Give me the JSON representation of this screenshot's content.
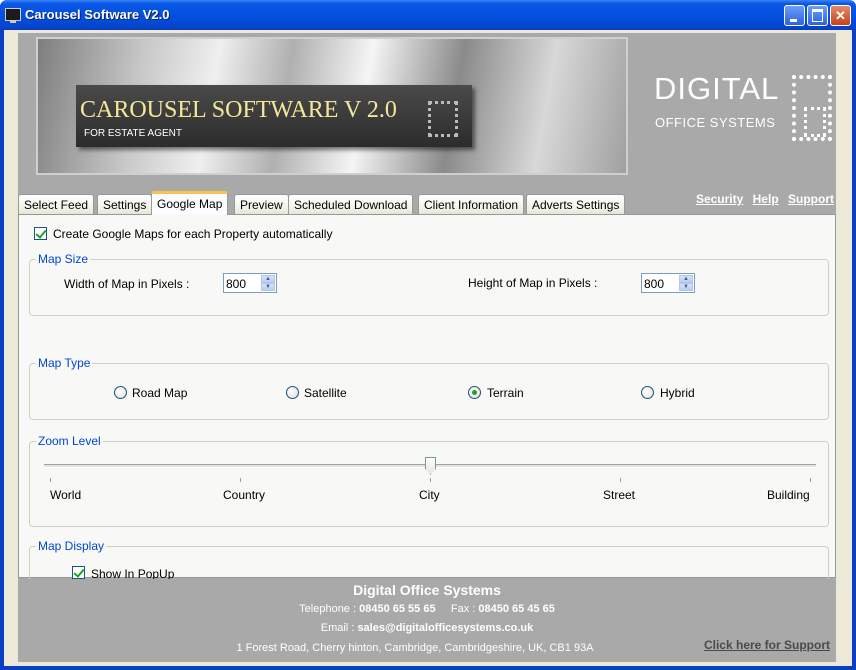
{
  "window": {
    "title": "Carousel Software V2.0"
  },
  "banner": {
    "title": "CAROUSEL SOFTWARE V 2.0",
    "subtitle": "FOR ESTATE AGENT",
    "brand_big": "DIGITAL",
    "brand_small": "OFFICE SYSTEMS"
  },
  "tabs": [
    {
      "label": "Select Feed",
      "active": false
    },
    {
      "label": "Settings",
      "active": false
    },
    {
      "label": "Google Map",
      "active": true
    },
    {
      "label": "Preview",
      "active": false
    },
    {
      "label": "Scheduled Download",
      "active": false
    },
    {
      "label": "Client Information",
      "active": false
    },
    {
      "label": "Adverts Settings",
      "active": false
    }
  ],
  "links": {
    "security": "Security",
    "help": "Help",
    "support": "Support"
  },
  "google_map": {
    "create_maps_label": "Create Google Maps for each Property automatically",
    "create_maps_checked": true,
    "map_size": {
      "title": "Map Size",
      "width_label": "Width of Map in Pixels :",
      "width_value": "800",
      "height_label": "Height of Map in Pixels :",
      "height_value": "800"
    },
    "map_type": {
      "title": "Map Type",
      "options": [
        "Road Map",
        "Satellite",
        "Terrain",
        "Hybrid"
      ],
      "selected": "Terrain"
    },
    "zoom": {
      "title": "Zoom Level",
      "labels": [
        "World",
        "Country",
        "City",
        "Street",
        "Building"
      ],
      "value_fraction": 0.5
    },
    "map_display": {
      "title": "Map Display",
      "popup_label": "Show In PopUp",
      "popup_checked": true
    }
  },
  "footer": {
    "company": "Digital Office Systems",
    "telephone_label": "Telephone :",
    "telephone": "08450 65 55 65",
    "fax_label": "Fax :",
    "fax": "08450 65 45 65",
    "email_label": "Email :",
    "email": "sales@digitalofficesystems.co.uk",
    "address": "1 Forest Road, Cherry hinton, Cambridge, Cambridgeshire, UK, CB1 93A",
    "support_link": "Click here for Support"
  }
}
